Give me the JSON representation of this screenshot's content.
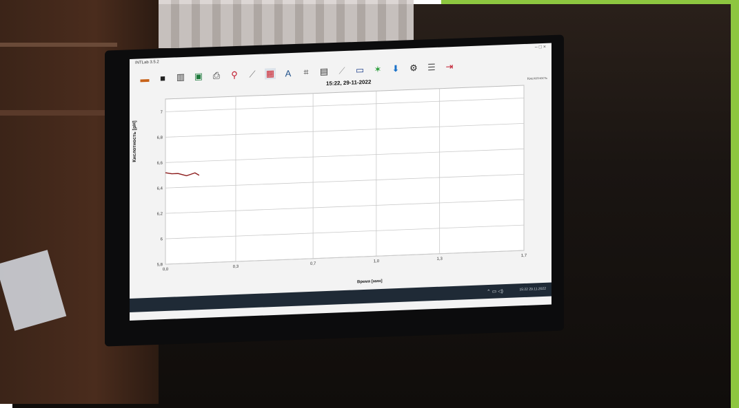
{
  "window": {
    "title": "INTLab 3.5.2",
    "controls": "– □ ×"
  },
  "chart_data": {
    "type": "line",
    "title": "15:22, 29-11-2022",
    "xlabel": "Время [мин]",
    "ylabel": "Кислотность [pH]",
    "xlim": [
      0.0,
      1.7
    ],
    "ylim": [
      5.8,
      7.1
    ],
    "x_ticks": [
      "0,0",
      "0,3",
      "0,7",
      "1,0",
      "1,3",
      "1,7"
    ],
    "y_ticks": [
      "5,8",
      "6",
      "6,2",
      "6,4",
      "6,6",
      "6,8",
      "7"
    ],
    "series": [
      {
        "color": "#8b1a1a",
        "x": [
          0.0,
          0.03,
          0.06,
          0.08,
          0.1,
          0.12,
          0.14,
          0.16
        ],
        "y": [
          6.52,
          6.51,
          6.51,
          6.5,
          6.49,
          6.5,
          6.51,
          6.49
        ]
      }
    ],
    "legend": {
      "position": "top-right",
      "text": "Кислотность"
    },
    "grid": true
  },
  "taskbar": {
    "time": "15:22",
    "date": "29.11.2022"
  }
}
